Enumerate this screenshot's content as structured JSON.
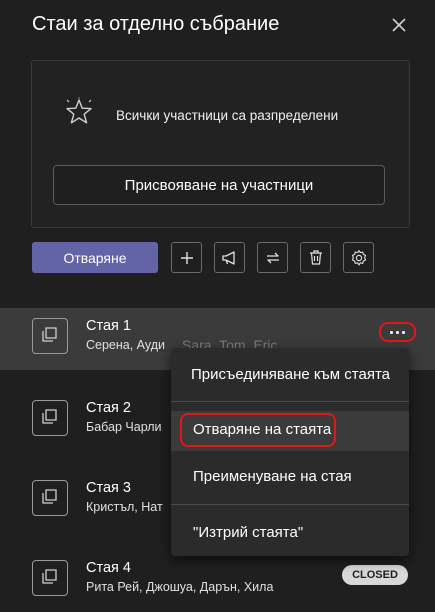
{
  "header": {
    "title": "Стаи за отделно събрание"
  },
  "status_card": {
    "message": "Всички участници са разпределени",
    "assign_label": "Присвояване на участници"
  },
  "toolbar": {
    "open_label": "Отваряне"
  },
  "rooms": [
    {
      "name": "Стая 1",
      "members": "Серена, Ауди",
      "members_extra": "Sara, Tom, Eric"
    },
    {
      "name": "Стая 2",
      "members": "Бабар Чарли"
    },
    {
      "name": "Стая 3",
      "members": "Кристъл, Нат"
    },
    {
      "name": "Стая 4",
      "members": "Рита Рей, Джошуа, Дарън, Хила",
      "status": "CLOSED"
    }
  ],
  "context_menu": {
    "join": "Присъединяване към стаята",
    "open": "Отваряне на стаята",
    "rename": "Преименуване на стая",
    "delete": "\"Изтрий стаята\""
  },
  "colors": {
    "background": "#1f1f1f",
    "accent": "#6264a7",
    "selected_row": "#3b3b3b",
    "highlight_ring": "#e01818"
  }
}
